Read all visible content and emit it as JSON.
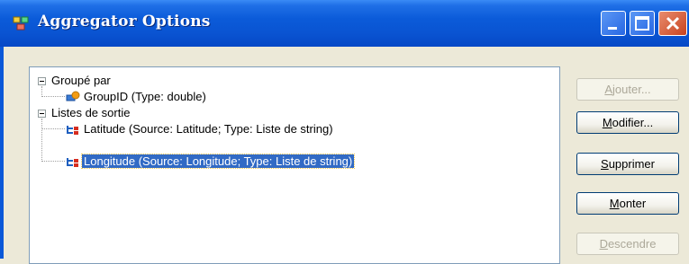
{
  "window": {
    "title": "Aggregator Options"
  },
  "tree": {
    "groups": [
      {
        "label": "Groupé par",
        "children": [
          {
            "label": "GroupID (Type: double)",
            "selected": false
          }
        ]
      },
      {
        "label": "Listes de sortie",
        "children": [
          {
            "label": "Latitude (Source: Latitude; Type: Liste de string)",
            "selected": false
          },
          {
            "label": "Longitude (Source: Longitude; Type: Liste de string)",
            "selected": true
          }
        ]
      }
    ]
  },
  "buttons": [
    {
      "label_mnemonic": "A",
      "label_rest": "jouter...",
      "enabled": false
    },
    {
      "label_mnemonic": "M",
      "label_rest": "odifier...",
      "enabled": true
    },
    {
      "label_mnemonic": "S",
      "label_rest": "upprimer",
      "enabled": true
    },
    {
      "label_mnemonic": "M",
      "label_rest": "onter",
      "enabled": true
    },
    {
      "label_mnemonic": "D",
      "label_rest": "escendre",
      "enabled": false
    }
  ],
  "colors": {
    "titlebar": "#0A54D2",
    "selection": "#316AC5",
    "window_bg": "#ECE9D8"
  }
}
